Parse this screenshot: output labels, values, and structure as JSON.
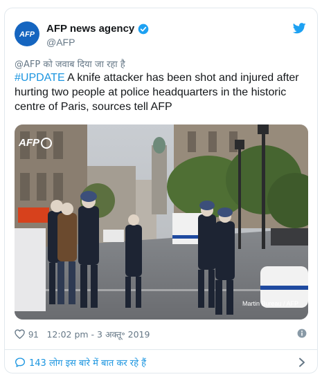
{
  "account": {
    "display_name": "AFP news agency",
    "handle": "@AFP",
    "avatar_text": "AFP",
    "verified": true,
    "avatar_color": "#1565c0"
  },
  "tweet": {
    "reply_to": "@AFP को जवाब दिया जा रहा है",
    "hashtag": "#UPDATE",
    "text": " A knife attacker has been shot and injured after hurting two people at police headquarters in the historic centre of Paris, sources tell AFP"
  },
  "media": {
    "watermark": "AFP",
    "credit": "Martin Bureau / AFP"
  },
  "meta": {
    "likes": "91",
    "timestamp": "12:02 pm - 3 अक्तू॰ 2019"
  },
  "conversation": {
    "label": "143 लोग इस बारे में बात कर रहे हैं"
  },
  "icons": {
    "brand": "twitter-bird-icon",
    "like": "heart-icon",
    "info": "info-icon",
    "reply": "speech-bubble-icon",
    "more": "chevron-right-icon"
  },
  "colors": {
    "link": "#1b95e0",
    "secondary_text": "#657786",
    "border": "#e1e8ed"
  }
}
